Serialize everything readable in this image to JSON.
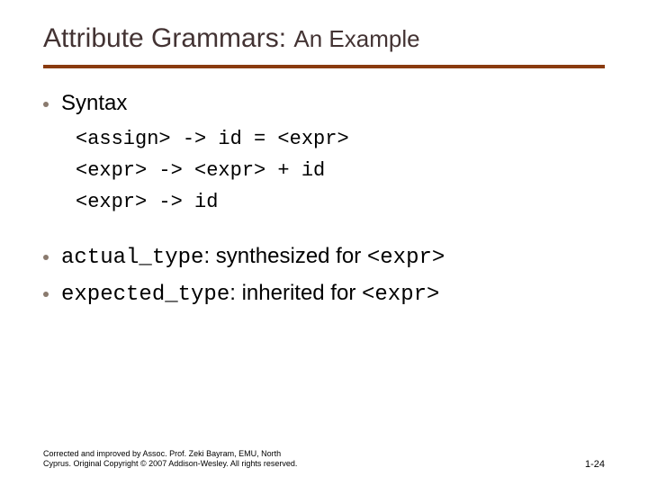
{
  "title": {
    "main": "Attribute Grammars:",
    "sub": "An Example"
  },
  "bullets": {
    "syntax_label": "Syntax",
    "grammar": {
      "line1": "<assign> -> id = <expr>",
      "line2": "<expr> -> <expr> + id",
      "line3": "<expr> -> id"
    },
    "actual": {
      "code": "actual_type",
      "mid": ": synthesized for ",
      "tail": "<expr>"
    },
    "expected": {
      "code": "expected_type",
      "mid": ": inherited for ",
      "tail": "<expr>"
    }
  },
  "footer": {
    "line1": "Corrected and improved by Assoc. Prof. Zeki Bayram, EMU, North",
    "line2": "Cyprus. Original Copyright © 2007 Addison-Wesley. All rights reserved."
  },
  "page": "1-24"
}
